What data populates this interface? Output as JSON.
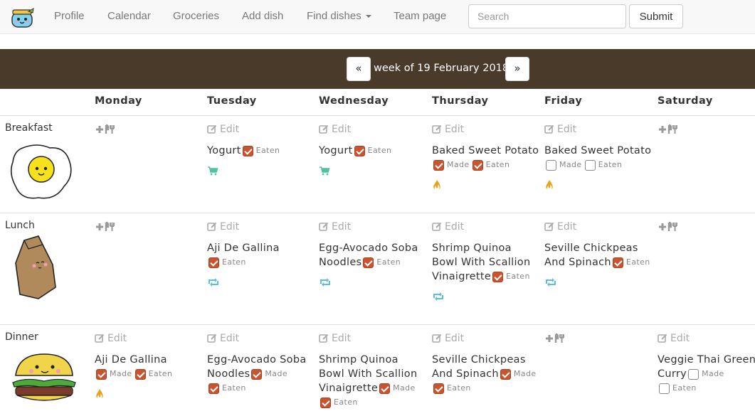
{
  "nav": {
    "items": [
      "Profile",
      "Calendar",
      "Groceries",
      "Add dish",
      "Find dishes",
      "Team page"
    ],
    "search_placeholder": "Search",
    "submit": "Submit"
  },
  "week": {
    "prev": "«",
    "label": "week of 19 February 2018",
    "next": "»"
  },
  "days": [
    "Monday",
    "Tuesday",
    "Wednesday",
    "Thursday",
    "Friday",
    "Saturday"
  ],
  "meals": [
    "Breakfast",
    "Lunch",
    "Dinner"
  ],
  "labels": {
    "edit": "Edit",
    "made": "Made",
    "eaten": "Eaten"
  },
  "grid": [
    [
      {
        "empty": true
      },
      {
        "dish": "Yogurt",
        "eaten": true,
        "icon": "cart-icon"
      },
      {
        "dish": "Yogurt",
        "eaten": true,
        "icon": "cart-icon"
      },
      {
        "dish": "Baked Sweet Potato",
        "made": true,
        "eaten": true,
        "icon": "fire-icon"
      },
      {
        "dish": "Baked Sweet Potato",
        "made": false,
        "eaten": false,
        "icon": "fire-icon"
      },
      {
        "empty": true
      }
    ],
    [
      {
        "empty": true
      },
      {
        "dish": "Aji De Gallina",
        "eaten": true,
        "icon": "repeat-icon"
      },
      {
        "dish": "Egg-Avocado Soba Noodles",
        "eaten": true,
        "icon": "repeat-icon"
      },
      {
        "dish": "Shrimp Quinoa Bowl With Scallion Vinaigrette",
        "eaten": true,
        "icon": "repeat-icon"
      },
      {
        "dish": "Seville Chickpeas And Spinach",
        "eaten": true,
        "icon": "repeat-icon"
      },
      {
        "empty": true
      }
    ],
    [
      {
        "dish": "Aji De Gallina",
        "made": true,
        "eaten": true,
        "icon": "fire-icon"
      },
      {
        "dish": "Egg-Avocado Soba Noodles",
        "made": true,
        "eaten": true
      },
      {
        "dish": "Shrimp Quinoa Bowl With Scallion Vinaigrette",
        "made": true,
        "eaten": true
      },
      {
        "dish": "Seville Chickpeas And Spinach",
        "made": true,
        "eaten": true
      },
      {
        "empty": true
      },
      {
        "dish": "Veggie Thai Green Curry",
        "made": false,
        "eaten": false
      }
    ]
  ],
  "colors": {
    "header_bar": "#4a3a2a",
    "checkbox": "#c95530",
    "cart": "#4fc3a1",
    "repeat": "#5bc0de",
    "fire": "#e8a317"
  }
}
